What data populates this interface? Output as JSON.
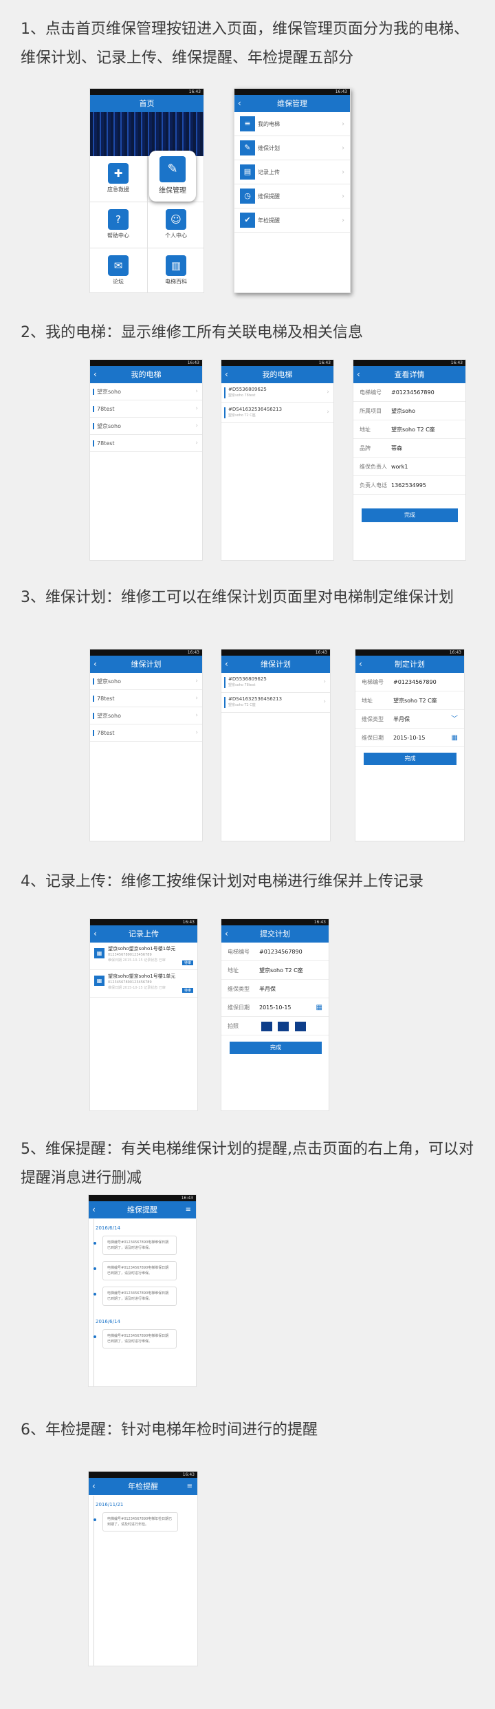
{
  "sections": [
    {
      "heading": "1、点击首页维保管理按钮进入页面，维保管理页面分为我的电梯、维保计划、记录上传、维保提醒、年检提醒五部分"
    },
    {
      "heading": "2、我的电梯：显示维修工所有关联电梯及相关信息"
    },
    {
      "heading": "3、维保计划：维修工可以在维保计划页面里对电梯制定维保计划"
    },
    {
      "heading": "4、记录上传：维修工按维保计划对电梯进行维保并上传记录"
    },
    {
      "heading": "5、维保提醒：有关电梯维保计划的提醒,点击页面的右上角，可以对提醒消息进行删减"
    },
    {
      "heading": "6、年检提醒：针对电梯年检时间进行的提醒"
    }
  ],
  "status_time": "16:43",
  "screens": {
    "home": {
      "title": "首页",
      "tiles": [
        {
          "label": "应急救援",
          "icon": "ambulance-icon",
          "glyph": "✚"
        },
        {
          "label": "维保管理",
          "icon": "wrench-icon",
          "glyph": "✎"
        },
        {
          "label": "帮助中心",
          "icon": "question-icon",
          "glyph": "?"
        },
        {
          "label": "个人中心",
          "icon": "user-icon",
          "glyph": "☺"
        },
        {
          "label": "论坛",
          "icon": "chat-icon",
          "glyph": "✉"
        },
        {
          "label": "电梯百科",
          "icon": "books-icon",
          "glyph": "▥"
        }
      ]
    },
    "maint_menu": {
      "title": "维保管理",
      "items": [
        {
          "label": "我的电梯",
          "icon": "elevator-icon",
          "glyph": "≡"
        },
        {
          "label": "维保计划",
          "icon": "plan-icon",
          "glyph": "✎"
        },
        {
          "label": "记录上传",
          "icon": "upload-icon",
          "glyph": "▤"
        },
        {
          "label": "维保提醒",
          "icon": "alarm-icon",
          "glyph": "◷"
        },
        {
          "label": "年检提醒",
          "icon": "inspect-icon",
          "glyph": "✔"
        }
      ]
    },
    "my_elev_a": {
      "title": "我的电梯",
      "items": [
        "望京soho",
        "78test",
        "望京soho",
        "78test"
      ]
    },
    "my_elev_b": {
      "title": "我的电梯",
      "items": [
        {
          "title": "#D5536809625",
          "sub": "望京soho  78test"
        },
        {
          "title": "#DS416325364S6213",
          "sub": "望京soho T2 C座"
        }
      ]
    },
    "detail": {
      "title": "查看详情",
      "fields": [
        {
          "k": "电梯编号",
          "v": "#01234567890"
        },
        {
          "k": "所属项目",
          "v": "望京soho"
        },
        {
          "k": "地址",
          "v": "望京soho  T2  C座"
        },
        {
          "k": "品牌",
          "v": "蒂森"
        },
        {
          "k": "维保负责人",
          "v": "work1"
        },
        {
          "k": "负责人电话",
          "v": "1362534995"
        }
      ],
      "button": "完成"
    },
    "plan_a": {
      "title": "维保计划",
      "items": [
        "望京soho",
        "78test",
        "望京soho",
        "78test"
      ]
    },
    "plan_b": {
      "title": "维保计划",
      "items": [
        {
          "title": "#D5536809625",
          "sub": "望京soho  78test"
        },
        {
          "title": "#DS416325364S6213",
          "sub": "望京soho T2 C座"
        }
      ]
    },
    "make_plan": {
      "title": "制定计划",
      "fields": [
        {
          "k": "电梯编号",
          "v": "#01234567890",
          "icon": ""
        },
        {
          "k": "地址",
          "v": "望京soho  T2  C座",
          "icon": ""
        },
        {
          "k": "维保类型",
          "v": "半月保",
          "icon": "﹀"
        },
        {
          "k": "维保日期",
          "v": "2015-10-15",
          "icon": "▦"
        }
      ],
      "button": "完成"
    },
    "upload": {
      "title": "记录上传",
      "records": [
        {
          "title": "望京soho望京soho1号楼1单元",
          "sub": "01234567890123456789",
          "meta": "维保日期 2015-10-15   记录状态 已审",
          "tag": "待审"
        },
        {
          "title": "望京soho望京soho1号楼1单元",
          "sub": "01234567890123456789",
          "meta": "维保日期 2015-10-15   记录状态 已审",
          "tag": "待审"
        }
      ]
    },
    "submit": {
      "title": "提交计划",
      "fields": [
        {
          "k": "电梯编号",
          "v": "#01234567890"
        },
        {
          "k": "地址",
          "v": "望京soho  T2  C座"
        },
        {
          "k": "维保类型",
          "v": "半月保"
        },
        {
          "k": "维保日期",
          "v": "2015-10-15"
        },
        {
          "k": "拍照",
          "v": ""
        }
      ],
      "button": "完成"
    },
    "remind": {
      "title": "维保提醒",
      "groups": [
        {
          "date": "2016/6/14",
          "cards": [
            "电梯编号#01234567890电梯维保日期已到期了，请及时进行维保。",
            "电梯编号#01234567890电梯维保日期已到期了，请及时进行维保。",
            "电梯编号#01234567890电梯维保日期已到期了，请及时进行维保。"
          ]
        },
        {
          "date": "2016/6/14",
          "cards": [
            "电梯编号#01234567890电梯维保日期已到期了，请及时进行维保。"
          ]
        }
      ]
    },
    "annual": {
      "title": "年检提醒",
      "groups": [
        {
          "date": "2016/11/21",
          "cards": [
            "电梯编号#01234567890电梯年检日期已到期了，请及时进行年检。"
          ]
        }
      ]
    }
  }
}
